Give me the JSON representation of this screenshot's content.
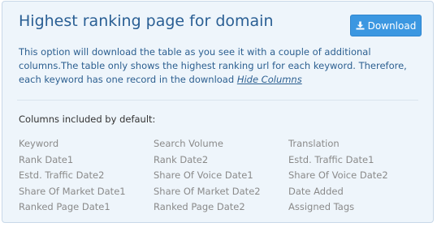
{
  "panel": {
    "title": "Highest ranking page for domain",
    "download_label": "Download",
    "description": "This option will download the table as you see it with a couple of additional columns.The table only shows the highest ranking url for each keyword. Therefore, each keyword has one record in the download",
    "hide_columns_link": "Hide Columns",
    "columns_heading": "Columns included by default:",
    "columns": [
      "Keyword",
      "Search Volume",
      "Translation",
      "Rank Date1",
      "Rank Date2",
      "Estd. Traffic Date1",
      "Estd. Traffic Date2",
      "Share Of Voice Date1",
      "Share Of Voice Date2",
      "Share Of Market Date1",
      "Share Of Market Date2",
      "Date Added",
      "Ranked Page Date1",
      "Ranked Page Date2",
      "Assigned Tags"
    ]
  },
  "colors": {
    "accent": "#3b97e1",
    "title": "#2a5f94",
    "panel_background": "#eef5fb"
  },
  "icons": {
    "download": "download-icon"
  }
}
